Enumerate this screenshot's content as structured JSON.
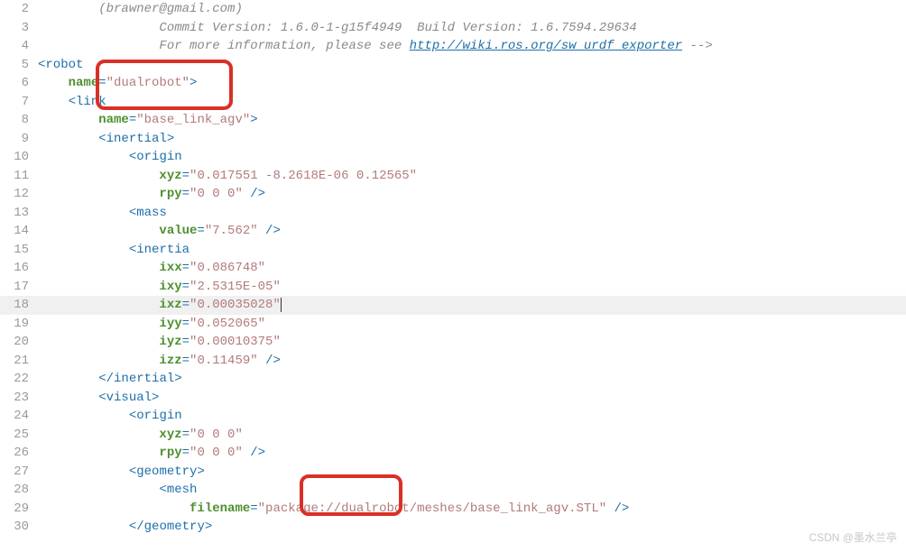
{
  "lines": [
    {
      "n": "2",
      "indent": 4,
      "segs": [
        {
          "t": "(",
          "c": "c-comment"
        },
        {
          "t": "brawner@gmail.com",
          "c": "c-comment"
        },
        {
          "t": ")",
          "c": "c-comment"
        }
      ]
    },
    {
      "n": "3",
      "indent": 8,
      "segs": [
        {
          "t": "Commit Version: 1.6.0-1-g15f4949  Build Version: 1.6.7594.29634",
          "c": "c-comment"
        }
      ]
    },
    {
      "n": "4",
      "indent": 8,
      "segs": [
        {
          "t": "For more information, please see ",
          "c": "c-comment"
        },
        {
          "t": "http://wiki.ros.org/sw_urdf_exporter",
          "c": "c-link"
        },
        {
          "t": " -->",
          "c": "c-comment"
        }
      ]
    },
    {
      "n": "5",
      "indent": 0,
      "segs": [
        {
          "t": "<",
          "c": "c-punc"
        },
        {
          "t": "robot",
          "c": "c-tag"
        }
      ]
    },
    {
      "n": "6",
      "indent": 2,
      "segs": [
        {
          "t": "name",
          "c": "c-attr"
        },
        {
          "t": "=",
          "c": "c-punc"
        },
        {
          "t": "\"dualrobot\"",
          "c": "c-str"
        },
        {
          "t": ">",
          "c": "c-punc"
        }
      ]
    },
    {
      "n": "7",
      "indent": 2,
      "segs": [
        {
          "t": "<",
          "c": "c-punc"
        },
        {
          "t": "link",
          "c": "c-tag"
        }
      ]
    },
    {
      "n": "8",
      "indent": 4,
      "segs": [
        {
          "t": "name",
          "c": "c-attr"
        },
        {
          "t": "=",
          "c": "c-punc"
        },
        {
          "t": "\"base_link_agv\"",
          "c": "c-str"
        },
        {
          "t": ">",
          "c": "c-punc"
        }
      ]
    },
    {
      "n": "9",
      "indent": 4,
      "segs": [
        {
          "t": "<",
          "c": "c-punc"
        },
        {
          "t": "inertial",
          "c": "c-tag"
        },
        {
          "t": ">",
          "c": "c-punc"
        }
      ]
    },
    {
      "n": "10",
      "indent": 6,
      "segs": [
        {
          "t": "<",
          "c": "c-punc"
        },
        {
          "t": "origin",
          "c": "c-tag"
        }
      ]
    },
    {
      "n": "11",
      "indent": 8,
      "segs": [
        {
          "t": "xyz",
          "c": "c-attr"
        },
        {
          "t": "=",
          "c": "c-punc"
        },
        {
          "t": "\"0.017551 -8.2618E-06 0.12565\"",
          "c": "c-str"
        }
      ]
    },
    {
      "n": "12",
      "indent": 8,
      "segs": [
        {
          "t": "rpy",
          "c": "c-attr"
        },
        {
          "t": "=",
          "c": "c-punc"
        },
        {
          "t": "\"0 0 0\"",
          "c": "c-str"
        },
        {
          "t": " />",
          "c": "c-punc"
        }
      ]
    },
    {
      "n": "13",
      "indent": 6,
      "segs": [
        {
          "t": "<",
          "c": "c-punc"
        },
        {
          "t": "mass",
          "c": "c-tag"
        }
      ]
    },
    {
      "n": "14",
      "indent": 8,
      "segs": [
        {
          "t": "value",
          "c": "c-attr"
        },
        {
          "t": "=",
          "c": "c-punc"
        },
        {
          "t": "\"7.562\"",
          "c": "c-str"
        },
        {
          "t": " />",
          "c": "c-punc"
        }
      ]
    },
    {
      "n": "15",
      "indent": 6,
      "segs": [
        {
          "t": "<",
          "c": "c-punc"
        },
        {
          "t": "inertia",
          "c": "c-tag"
        }
      ]
    },
    {
      "n": "16",
      "indent": 8,
      "segs": [
        {
          "t": "ixx",
          "c": "c-attr"
        },
        {
          "t": "=",
          "c": "c-punc"
        },
        {
          "t": "\"0.086748\"",
          "c": "c-str"
        }
      ]
    },
    {
      "n": "17",
      "indent": 8,
      "segs": [
        {
          "t": "ixy",
          "c": "c-attr"
        },
        {
          "t": "=",
          "c": "c-punc"
        },
        {
          "t": "\"2.5315E-05\"",
          "c": "c-str"
        }
      ]
    },
    {
      "n": "18",
      "indent": 8,
      "current": true,
      "segs": [
        {
          "t": "ixz",
          "c": "c-attr"
        },
        {
          "t": "=",
          "c": "c-punc"
        },
        {
          "t": "\"0.00035028\"",
          "c": "c-str"
        }
      ]
    },
    {
      "n": "19",
      "indent": 8,
      "segs": [
        {
          "t": "iyy",
          "c": "c-attr"
        },
        {
          "t": "=",
          "c": "c-punc"
        },
        {
          "t": "\"0.052065\"",
          "c": "c-str"
        }
      ]
    },
    {
      "n": "20",
      "indent": 8,
      "segs": [
        {
          "t": "iyz",
          "c": "c-attr"
        },
        {
          "t": "=",
          "c": "c-punc"
        },
        {
          "t": "\"0.00010375\"",
          "c": "c-str"
        }
      ]
    },
    {
      "n": "21",
      "indent": 8,
      "segs": [
        {
          "t": "izz",
          "c": "c-attr"
        },
        {
          "t": "=",
          "c": "c-punc"
        },
        {
          "t": "\"0.11459\"",
          "c": "c-str"
        },
        {
          "t": " />",
          "c": "c-punc"
        }
      ]
    },
    {
      "n": "22",
      "indent": 4,
      "segs": [
        {
          "t": "</",
          "c": "c-punc"
        },
        {
          "t": "inertial",
          "c": "c-tag"
        },
        {
          "t": ">",
          "c": "c-punc"
        }
      ]
    },
    {
      "n": "23",
      "indent": 4,
      "segs": [
        {
          "t": "<",
          "c": "c-punc"
        },
        {
          "t": "visual",
          "c": "c-tag"
        },
        {
          "t": ">",
          "c": "c-punc"
        }
      ]
    },
    {
      "n": "24",
      "indent": 6,
      "segs": [
        {
          "t": "<",
          "c": "c-punc"
        },
        {
          "t": "origin",
          "c": "c-tag"
        }
      ]
    },
    {
      "n": "25",
      "indent": 8,
      "segs": [
        {
          "t": "xyz",
          "c": "c-attr"
        },
        {
          "t": "=",
          "c": "c-punc"
        },
        {
          "t": "\"0 0 0\"",
          "c": "c-str"
        }
      ]
    },
    {
      "n": "26",
      "indent": 8,
      "segs": [
        {
          "t": "rpy",
          "c": "c-attr"
        },
        {
          "t": "=",
          "c": "c-punc"
        },
        {
          "t": "\"0 0 0\"",
          "c": "c-str"
        },
        {
          "t": " />",
          "c": "c-punc"
        }
      ]
    },
    {
      "n": "27",
      "indent": 6,
      "segs": [
        {
          "t": "<",
          "c": "c-punc"
        },
        {
          "t": "geometry",
          "c": "c-tag"
        },
        {
          "t": ">",
          "c": "c-punc"
        }
      ]
    },
    {
      "n": "28",
      "indent": 8,
      "segs": [
        {
          "t": "<",
          "c": "c-punc"
        },
        {
          "t": "mesh",
          "c": "c-tag"
        }
      ]
    },
    {
      "n": "29",
      "indent": 10,
      "segs": [
        {
          "t": "filename",
          "c": "c-attr"
        },
        {
          "t": "=",
          "c": "c-punc"
        },
        {
          "t": "\"package://dualrobot/meshes/base_link_agv.STL\"",
          "c": "c-str"
        },
        {
          "t": " />",
          "c": "c-punc"
        }
      ]
    },
    {
      "n": "30",
      "indent": 6,
      "segs": [
        {
          "t": "</",
          "c": "c-punc"
        },
        {
          "t": "geometry",
          "c": "c-tag"
        },
        {
          "t": ">",
          "c": "c-punc"
        }
      ]
    }
  ],
  "watermark": "CSDN @墨水兰亭"
}
